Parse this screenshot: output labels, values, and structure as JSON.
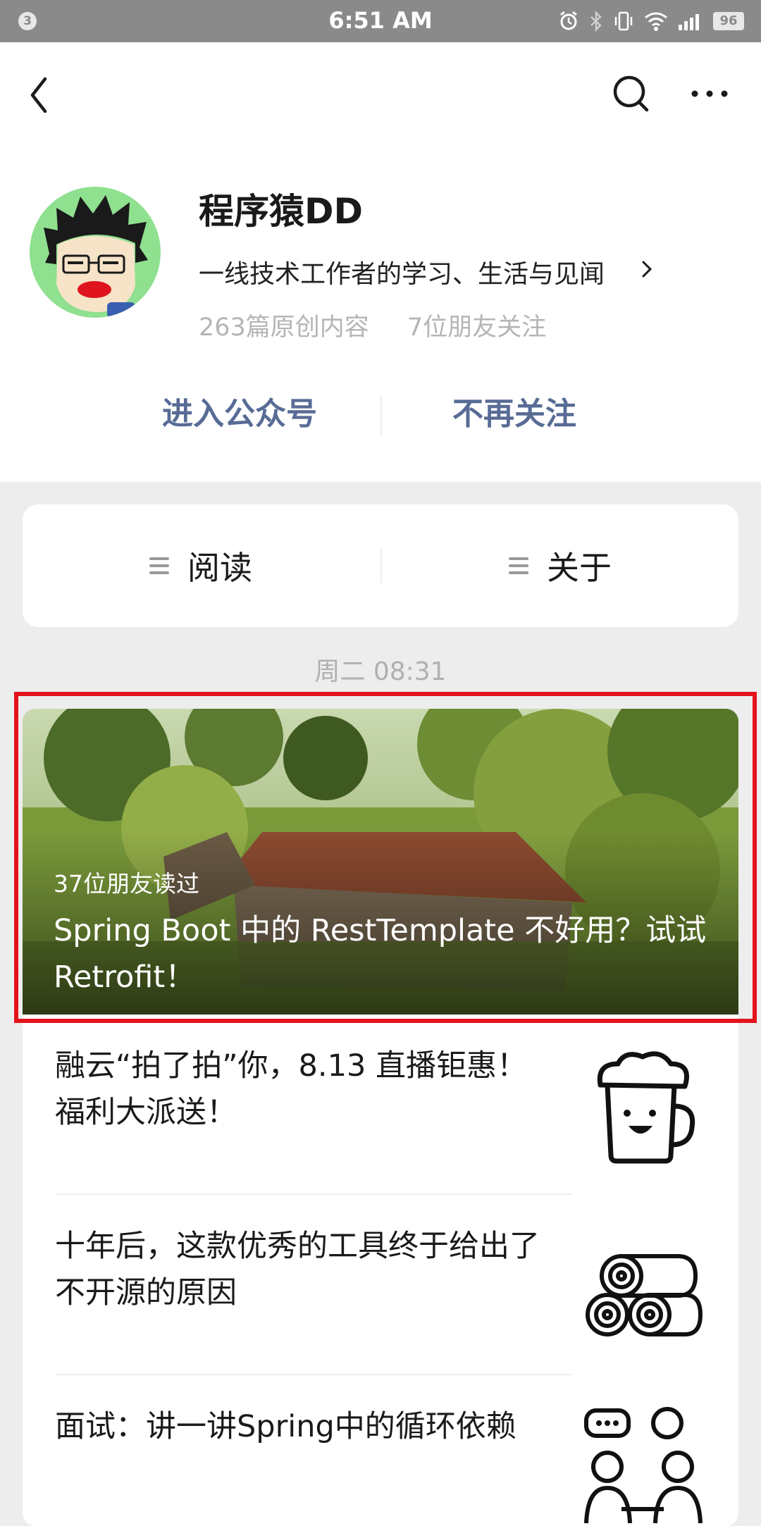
{
  "status_bar": {
    "notification_count": "3",
    "time": "6:51 AM",
    "battery": "96",
    "icons": [
      "alarm-icon",
      "bluetooth-icon",
      "vibrate-icon",
      "wifi-icon",
      "signal-icon",
      "battery-icon"
    ]
  },
  "nav": {
    "back_icon": "chevron-left-icon",
    "search_icon": "search-icon",
    "more_icon": "more-horizontal-icon"
  },
  "account": {
    "name": "程序猿DD",
    "description": "一线技术工作者的学习、生活与见闻",
    "original_count": "263篇原创内容",
    "friends_following": "7位朋友关注"
  },
  "actions": {
    "enter": "进入公众号",
    "unfollow": "不再关注"
  },
  "tabs": [
    {
      "label": "阅读",
      "icon": "menu-icon"
    },
    {
      "label": "关于",
      "icon": "menu-icon"
    }
  ],
  "feed": {
    "timestamp": "周二 08:31",
    "featured": {
      "readers": "37位朋友读过",
      "title": "Spring Boot 中的 RestTemplate 不好用？试试 Retrofit！"
    },
    "articles": [
      {
        "title": "融云“拍了拍”你，8.13 直播钜惠！福利大派送！",
        "thumb": "beer-mug-icon"
      },
      {
        "title": "十年后，这款优秀的工具终于给出了不开源的原因",
        "thumb": "logs-icon"
      },
      {
        "title": "面试：讲一讲Spring中的循环依赖",
        "thumb": "people-chat-icon"
      }
    ]
  },
  "colors": {
    "link": "#576b95",
    "highlight": "#e3131c",
    "status_bar": "#8a8a8a",
    "background": "#ededed"
  }
}
